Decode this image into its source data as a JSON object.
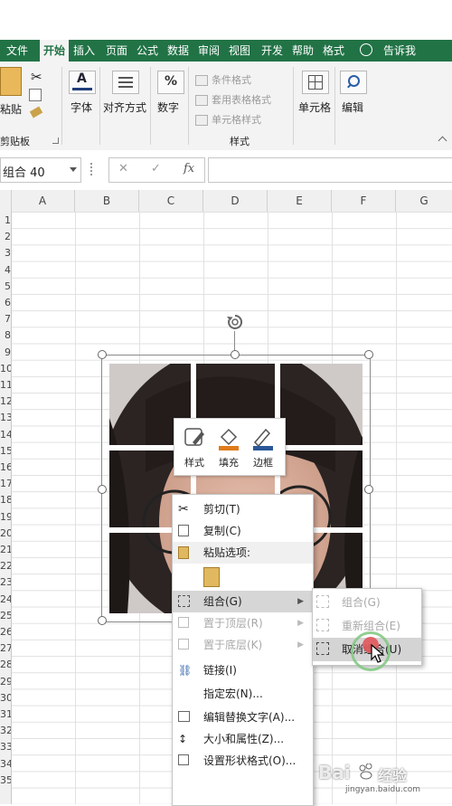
{
  "ribbon_tabs": [
    "文件",
    "开始",
    "插入",
    "页面",
    "公式",
    "数据",
    "审阅",
    "视图",
    "开发",
    "帮助",
    "格式",
    "告诉我"
  ],
  "active_tab": "开始",
  "ribbon": {
    "paste_label": "粘贴",
    "clipboard_group": "剪贴板",
    "font_label": "字体",
    "align_label": "对齐方式",
    "number_label": "数字",
    "cond_format": "条件格式",
    "table_format": "套用表格格式",
    "cell_style": "单元格样式",
    "styles_group": "样式",
    "cells_label": "单元格",
    "edit_label": "编辑"
  },
  "formula_bar": {
    "name_box": "组合 40",
    "cancel_symbol": "✕",
    "enter_symbol": "✓",
    "fx_symbol": "fx",
    "formula": ""
  },
  "columns": [
    "A",
    "B",
    "C",
    "D",
    "E",
    "F",
    "G"
  ],
  "rows": [
    "1",
    "2",
    "3",
    "4",
    "5",
    "6",
    "7",
    "8",
    "9",
    "10",
    "11",
    "12",
    "13",
    "14",
    "15",
    "16",
    "17",
    "18",
    "19",
    "20",
    "21",
    "22",
    "23",
    "24",
    "25",
    "26",
    "27",
    "28",
    "29",
    "30",
    "31",
    "32",
    "33",
    "34",
    "35"
  ],
  "mini_toolbar": {
    "style": "样式",
    "fill": "填充",
    "border": "边框"
  },
  "context_menu": {
    "cut": "剪切(T)",
    "copy": "复制(C)",
    "paste_options": "粘贴选项:",
    "group": "组合(G)",
    "bring_front": "置于顶层(R)",
    "send_back": "置于底层(K)",
    "link": "链接(I)",
    "macro": "指定宏(N)...",
    "alt_text": "编辑替换文字(A)...",
    "size_props": "大小和属性(Z)...",
    "format_shape": "设置形状格式(O)..."
  },
  "submenu": {
    "group": "组合(G)",
    "regroup": "重新组合(E)",
    "ungroup": "取消组合(U)"
  },
  "watermark": {
    "brand": "Bai",
    "brand2": "经验",
    "url": "jingyan.baidu.com"
  },
  "colors": {
    "excel_green": "#217346",
    "ribbon_bg": "#f3f3f3"
  }
}
